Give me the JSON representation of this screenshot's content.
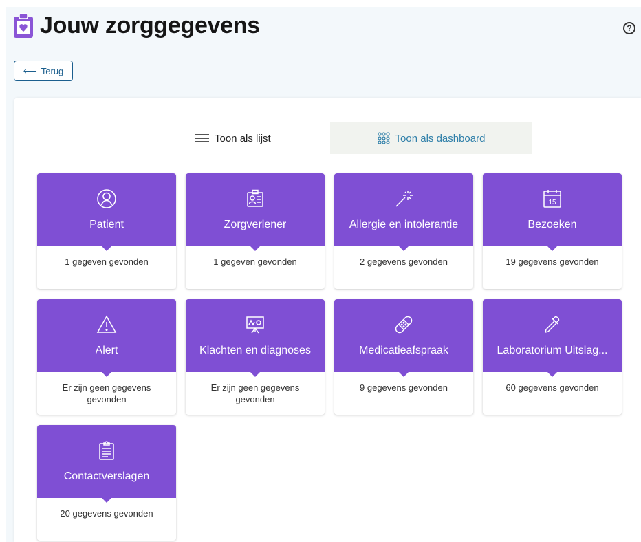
{
  "header": {
    "title": "Jouw zorggegevens",
    "help_symbol": "?"
  },
  "back": {
    "label": "Terug",
    "arrow": "⟵"
  },
  "toggle": {
    "list_label": "Toon als lijst",
    "dashboard_label": "Toon als dashboard",
    "active": "dashboard"
  },
  "colors": {
    "card_purple": "#7f4fd4",
    "accent_blue": "#1c5f8e",
    "dashboard_text": "#2f7fa9"
  },
  "cards": [
    {
      "title": "Patient",
      "count": "1 gegeven gevonden",
      "icon": "person-circle-icon"
    },
    {
      "title": "Zorgverlener",
      "count": "1 gegeven gevonden",
      "icon": "id-badge-icon"
    },
    {
      "title": "Allergie en intolerantie",
      "count": "2 gegevens gevonden",
      "icon": "magic-wand-icon"
    },
    {
      "title": "Bezoeken",
      "count": "19 gegevens gevonden",
      "icon": "calendar-icon",
      "icon_text": "15"
    },
    {
      "title": "Alert",
      "count": "Er zijn geen gegevens gevonden",
      "icon": "warning-triangle-icon"
    },
    {
      "title": "Klachten en diagnoses",
      "count": "Er zijn geen gegevens gevonden",
      "icon": "presentation-chart-icon"
    },
    {
      "title": "Medicatieafspraak",
      "count": "9 gegevens gevonden",
      "icon": "bandage-icon"
    },
    {
      "title": "Laboratorium Uitslag...",
      "count": "60 gegevens gevonden",
      "icon": "pipette-icon"
    },
    {
      "title": "Contactverslagen",
      "count": "20 gegevens gevonden",
      "icon": "clipboard-icon"
    }
  ]
}
